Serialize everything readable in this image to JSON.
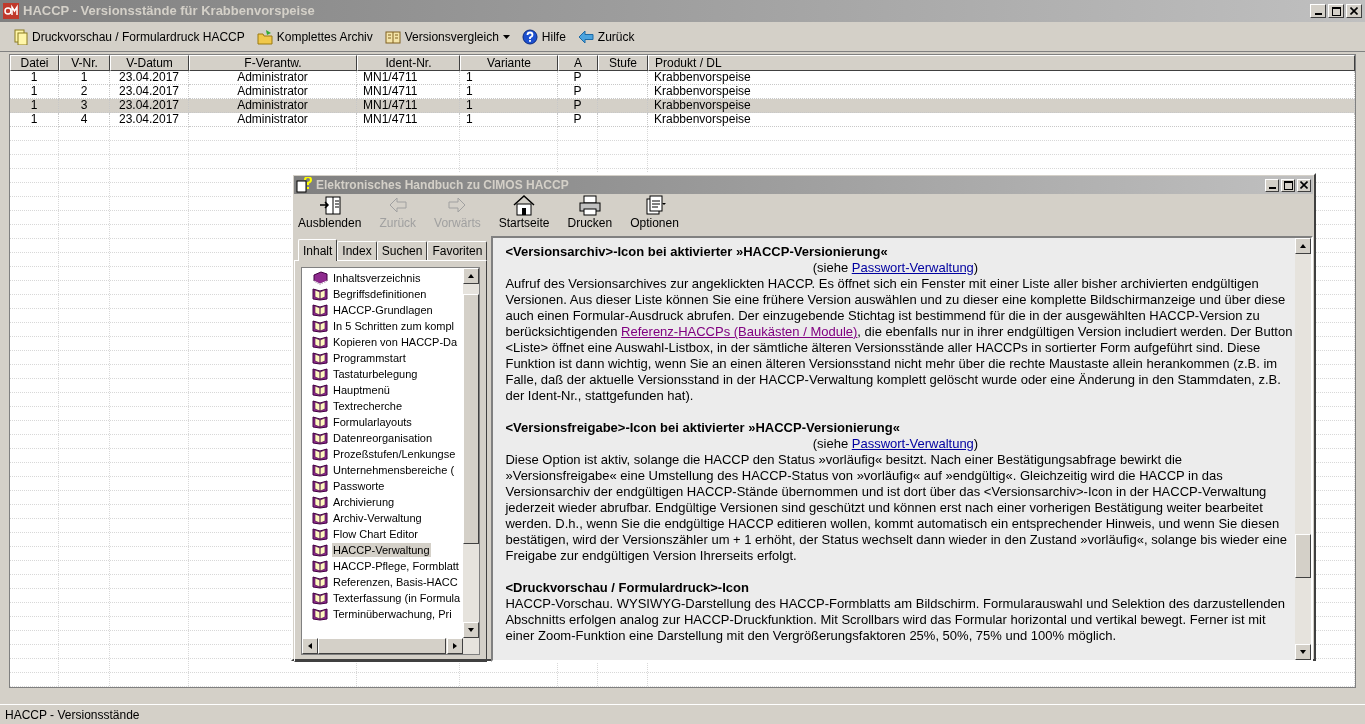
{
  "window": {
    "title": "HACCP - Versionsstände für Krabbenvorspeise"
  },
  "toolbar": [
    {
      "label": "Druckvorschau / Formulardruck HACCP",
      "kind": "print"
    },
    {
      "label": "Komplettes Archiv",
      "kind": "archive"
    },
    {
      "label": "Versionsvergleich",
      "kind": "compare"
    },
    {
      "label": "Hilfe",
      "kind": "help"
    },
    {
      "label": "Zurück",
      "kind": "back"
    }
  ],
  "table": {
    "columns": [
      "Datei",
      "V-Nr.",
      "V-Datum",
      "F-Verantw.",
      "Ident-Nr.",
      "Variante",
      "A",
      "Stufe",
      "Produkt / DL"
    ],
    "rows": [
      {
        "cells": [
          "1",
          "1",
          "23.04.2017",
          "Administrator",
          "MN1/4711",
          "1",
          "P",
          "",
          "Krabbenvorspeise"
        ],
        "selected": false
      },
      {
        "cells": [
          "1",
          "2",
          "23.04.2017",
          "Administrator",
          "MN1/4711",
          "1",
          "P",
          "",
          "Krabbenvorspeise"
        ],
        "selected": false
      },
      {
        "cells": [
          "1",
          "3",
          "23.04.2017",
          "Administrator",
          "MN1/4711",
          "1",
          "P",
          "",
          "Krabbenvorspeise"
        ],
        "selected": true
      },
      {
        "cells": [
          "1",
          "4",
          "23.04.2017",
          "Administrator",
          "MN1/4711",
          "1",
          "P",
          "",
          "Krabbenvorspeise"
        ],
        "selected": false
      }
    ]
  },
  "help_window": {
    "title": "Elektronisches Handbuch zu CIMOS HACCP",
    "toolbar": [
      {
        "label": "Ausblenden",
        "kind": "hide",
        "disabled": false
      },
      {
        "label": "Zurück",
        "kind": "back",
        "disabled": true
      },
      {
        "label": "Vorwärts",
        "kind": "forward",
        "disabled": true
      },
      {
        "label": "Startseite",
        "kind": "home",
        "disabled": false
      },
      {
        "label": "Drucken",
        "kind": "print",
        "disabled": false
      },
      {
        "label": "Optionen",
        "kind": "options",
        "disabled": false
      }
    ],
    "tabs": [
      {
        "label": "Inhalt",
        "selected": true
      },
      {
        "label": "Index",
        "selected": false
      },
      {
        "label": "Suchen",
        "selected": false
      },
      {
        "label": "Favoriten",
        "selected": false
      }
    ],
    "contents": [
      {
        "label": "Inhaltsverzeichnis",
        "kind": "closed-book",
        "selected": false
      },
      {
        "label": "Begriffsdefinitionen",
        "kind": "open-book",
        "selected": false
      },
      {
        "label": "HACCP-Grundlagen",
        "kind": "open-book",
        "selected": false
      },
      {
        "label": "In 5 Schritten zum kompl",
        "kind": "open-book",
        "selected": false
      },
      {
        "label": "Kopieren von HACCP-Da",
        "kind": "open-book",
        "selected": false
      },
      {
        "label": "Programmstart",
        "kind": "open-book",
        "selected": false
      },
      {
        "label": "Tastaturbelegung",
        "kind": "open-book",
        "selected": false
      },
      {
        "label": "Hauptmenü",
        "kind": "open-book",
        "selected": false
      },
      {
        "label": "Textrecherche",
        "kind": "open-book",
        "selected": false
      },
      {
        "label": "Formularlayouts",
        "kind": "open-book",
        "selected": false
      },
      {
        "label": "Datenreorganisation",
        "kind": "open-book",
        "selected": false
      },
      {
        "label": "Prozeßstufen/Lenkungse",
        "kind": "open-book",
        "selected": false
      },
      {
        "label": "Unternehmensbereiche (",
        "kind": "open-book",
        "selected": false
      },
      {
        "label": "Passworte",
        "kind": "open-book",
        "selected": false
      },
      {
        "label": "Archivierung",
        "kind": "open-book",
        "selected": false
      },
      {
        "label": "Archiv-Verwaltung",
        "kind": "open-book",
        "selected": false
      },
      {
        "label": "Flow Chart Editor",
        "kind": "open-book",
        "selected": false
      },
      {
        "label": "HACCP-Verwaltung",
        "kind": "open-book",
        "selected": true
      },
      {
        "label": "HACCP-Pflege, Formblatt",
        "kind": "open-book",
        "selected": false
      },
      {
        "label": "Referenzen, Basis-HACC",
        "kind": "open-book",
        "selected": false
      },
      {
        "label": "Texterfassung (in Formula",
        "kind": "open-book",
        "selected": false
      },
      {
        "label": "Terminüberwachung, Pri",
        "kind": "open-book",
        "selected": false
      }
    ],
    "sections": [
      {
        "heading": "<Versionsarchiv>-Icon bei aktivierter »HACCP-Versionierung«",
        "see_prefix": "(siehe ",
        "see_link": "Passwort-Verwaltung",
        "see_suffix": ")",
        "body": [
          {
            "text": "Aufruf des Versionsarchives zur angeklickten HACCP. Es öffnet sich ein Fenster mit einer Liste aller bisher archivierten endgültigen Versionen. Aus dieser Liste können Sie eine frühere Version auswählen und zu dieser eine komplette Bildschirmanzeige und über diese auch einen Formular-Ausdruck abrufen. Der einzugebende Stichtag ist bestimmend für die in der ausgewählten HACCP-Version zu berücksichtigenden ",
            "kind": "text"
          },
          {
            "text": "Referenz-HACCPs (Baukästen / Module)",
            "kind": "visited-link"
          },
          {
            "text": ", die ebenfalls nur in ihrer endgültigen Version includiert werden. Der Button <Liste> öffnet eine Auswahl-Listbox, in der sämtliche älteren Versionsstände aller HACCPs in sortierter Form aufgeführt sind. Diese Funktion ist dann wichtig, wenn Sie an einen älteren Versionsstand nicht mehr über die rechte Maustaste allein herankommen (z.B. im Falle, daß der aktuelle Versionsstand in der HACCP-Verwaltung komplett gelöscht wurde oder eine Änderung in den Stammdaten, z.B. der Ident-Nr., stattgefunden hat).",
            "kind": "text"
          }
        ]
      },
      {
        "heading": "<Versionsfreigabe>-Icon bei aktivierter »HACCP-Versionierung«",
        "see_prefix": "(siehe ",
        "see_link": "Passwort-Verwaltung",
        "see_suffix": ")",
        "body": [
          {
            "text": "Diese Option ist aktiv, solange die HACCP den Status »vorläufig« besitzt. Nach einer Bestätigungsabfrage bewirkt die »Versionsfreigabe« eine Umstellung des HACCP-Status von »vorläufig« auf »endgültig«. Gleichzeitig wird die HACCP in das Versionsarchiv der endgültigen HACCP-Stände übernommen und ist dort über das <Versionsarchiv>-Icon in der HACCP-Verwaltung jederzeit wieder abrufbar. Endgültige Versionen sind geschützt und können erst nach einer vorherigen Bestätigung weiter bearbeitet werden. D.h., wenn Sie die endgültige HACCP editieren wollen, kommt automatisch ein entsprechender Hinweis, und wenn Sie diesen bestätigen, wird der Versionszähler um + 1 erhöht, der Status wechselt dann wieder in den Zustand »vorläufig«, solange bis wieder eine Freigabe zur endgültigen Version Ihrerseits erfolgt.",
            "kind": "text"
          }
        ]
      },
      {
        "heading": "<Druckvorschau / Formulardruck>-Icon",
        "body": [
          {
            "text": "HACCP-Vorschau. WYSIWYG-Darstellung des HACCP-Formblatts am Bildschirm. Formularauswahl und Selektion des darzustellenden Abschnitts erfolgen analog zur HACCP-Druckfunktion. Mit Scrollbars wird das Formular horizontal und vertikal bewegt. Ferner ist mit einer Zoom-Funktion eine Darstellung mit den Vergrößerungsfaktoren 25%, 50%, 75% und 100% möglich.",
            "kind": "text"
          }
        ]
      }
    ]
  },
  "status_bar": {
    "text": "HACCP - Versionsstände"
  }
}
